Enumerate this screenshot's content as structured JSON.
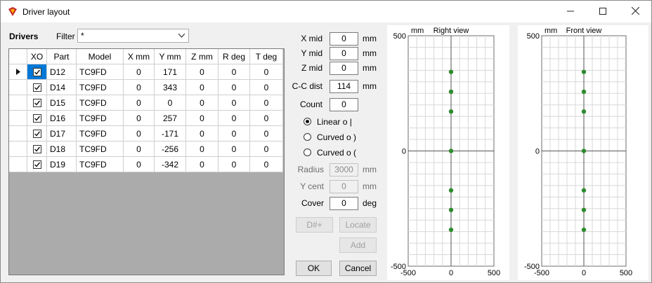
{
  "window": {
    "title": "Driver layout"
  },
  "drivers_panel": {
    "title": "Drivers",
    "filter_label": "Filter",
    "filter_value": "*",
    "columns": [
      "XO",
      "Part",
      "Model",
      "X mm",
      "Y mm",
      "Z mm",
      "R deg",
      "T deg"
    ],
    "rows": [
      {
        "xo": true,
        "part": "D12",
        "model": "TC9FD",
        "x": "0",
        "y": "171",
        "z": "0",
        "r": "0",
        "t": "0",
        "current": true
      },
      {
        "xo": true,
        "part": "D14",
        "model": "TC9FD",
        "x": "0",
        "y": "343",
        "z": "0",
        "r": "0",
        "t": "0"
      },
      {
        "xo": true,
        "part": "D15",
        "model": "TC9FD",
        "x": "0",
        "y": "0",
        "z": "0",
        "r": "0",
        "t": "0"
      },
      {
        "xo": true,
        "part": "D16",
        "model": "TC9FD",
        "x": "0",
        "y": "257",
        "z": "0",
        "r": "0",
        "t": "0"
      },
      {
        "xo": true,
        "part": "D17",
        "model": "TC9FD",
        "x": "0",
        "y": "-171",
        "z": "0",
        "r": "0",
        "t": "0"
      },
      {
        "xo": true,
        "part": "D18",
        "model": "TC9FD",
        "x": "0",
        "y": "-256",
        "z": "0",
        "r": "0",
        "t": "0"
      },
      {
        "xo": true,
        "part": "D19",
        "model": "TC9FD",
        "x": "0",
        "y": "-342",
        "z": "0",
        "r": "0",
        "t": "0"
      }
    ]
  },
  "controls": {
    "x_mid_label": "X mid",
    "x_mid_value": "0",
    "x_mid_unit": "mm",
    "y_mid_label": "Y mid",
    "y_mid_value": "0",
    "y_mid_unit": "mm",
    "z_mid_label": "Z mid",
    "z_mid_value": "0",
    "z_mid_unit": "mm",
    "cc_dist_label": "C-C dist",
    "cc_dist_value": "114",
    "cc_dist_unit": "mm",
    "count_label": "Count",
    "count_value": "0",
    "radio_linear": "Linear  o  |",
    "radio_curved1": "Curved  o  )",
    "radio_curved2": "Curved  o  (",
    "radius_label": "Radius",
    "radius_value": "3000",
    "radius_unit": "mm",
    "ycent_label": "Y cent",
    "ycent_value": "0",
    "ycent_unit": "mm",
    "cover_label": "Cover",
    "cover_value": "0",
    "cover_unit": "deg",
    "dplus_button": "D#+",
    "locate_button": "Locate",
    "add_button": "Add",
    "ok_button": "OK",
    "cancel_button": "Cancel"
  },
  "chart_data": [
    {
      "type": "scatter",
      "title": "Right view",
      "unit_label": "mm",
      "xlim": [
        -500,
        500
      ],
      "ylim": [
        -500,
        500
      ],
      "x_ticks": [
        "-500",
        "0",
        "500"
      ],
      "y_ticks": [
        "500",
        "0",
        "-500"
      ],
      "grid": true,
      "color": "#2e8b2e",
      "points": [
        [
          0,
          343
        ],
        [
          0,
          257
        ],
        [
          0,
          171
        ],
        [
          0,
          0
        ],
        [
          0,
          -171
        ],
        [
          0,
          -256
        ],
        [
          0,
          -342
        ]
      ]
    },
    {
      "type": "scatter",
      "title": "Front view",
      "unit_label": "mm",
      "xlim": [
        -500,
        500
      ],
      "ylim": [
        -500,
        500
      ],
      "x_ticks": [
        "-500",
        "0",
        "500"
      ],
      "y_ticks": [
        "500",
        "0",
        "-500"
      ],
      "grid": true,
      "color": "#2e8b2e",
      "points": [
        [
          0,
          343
        ],
        [
          0,
          257
        ],
        [
          0,
          171
        ],
        [
          0,
          0
        ],
        [
          0,
          -171
        ],
        [
          0,
          -256
        ],
        [
          0,
          -342
        ]
      ]
    }
  ]
}
